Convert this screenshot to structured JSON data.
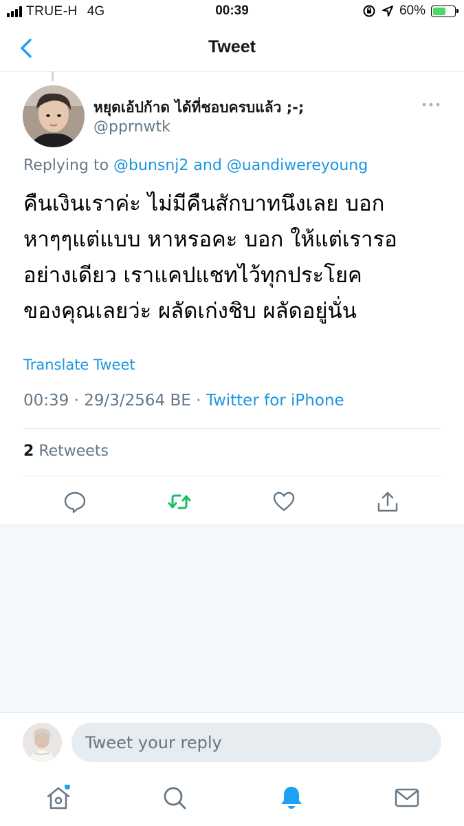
{
  "status_bar": {
    "carrier": "TRUE-H",
    "network": "4G",
    "time": "00:39",
    "battery_percent": "60%",
    "battery_level": 0.6
  },
  "nav": {
    "title": "Tweet"
  },
  "tweet": {
    "display_name": "หยุดเอ้ปก้าด ได้ที่ชอบครบแล้ว ;-;",
    "handle": "@pprnwtk",
    "replying_prefix": "Replying to",
    "replying_user_1": "@bunsnj2",
    "replying_and": "and",
    "replying_user_2": "@uandiwereyoung",
    "text_lines": [
      "คืนเงินเราค่ะ ไม่มีคืนสักบาทนึงเลย บอก",
      "หาๆๆแต่แบบ หาหรอคะ บอก ให้แต่เรารอ",
      "อย่างเดียว เราแคปแชทไว้ทุกประโยค",
      "ของคุณเลยว่ะ ผลัดเก่งชิบ ผลัดอยู่นั่น"
    ],
    "translate_label": "Translate Tweet",
    "timestamp": "00:39 · 29/3/2564 BE ·",
    "source": "Twitter for iPhone",
    "retweet_count": "2",
    "retweet_label": "Retweets"
  },
  "reply_bar": {
    "placeholder": "Tweet your reply"
  },
  "colors": {
    "accent": "#1da1f2",
    "link": "#1b95e0",
    "retweet_green": "#17bf63",
    "muted": "#657786"
  },
  "icons": {
    "back": "chevron-left-icon",
    "more": "more-dots-icon",
    "reply": "reply-bubble-icon",
    "retweet": "retweet-icon",
    "like": "heart-icon",
    "share": "share-icon",
    "home": "home-icon",
    "search": "search-icon",
    "notifications": "bell-icon",
    "messages": "mail-icon"
  }
}
